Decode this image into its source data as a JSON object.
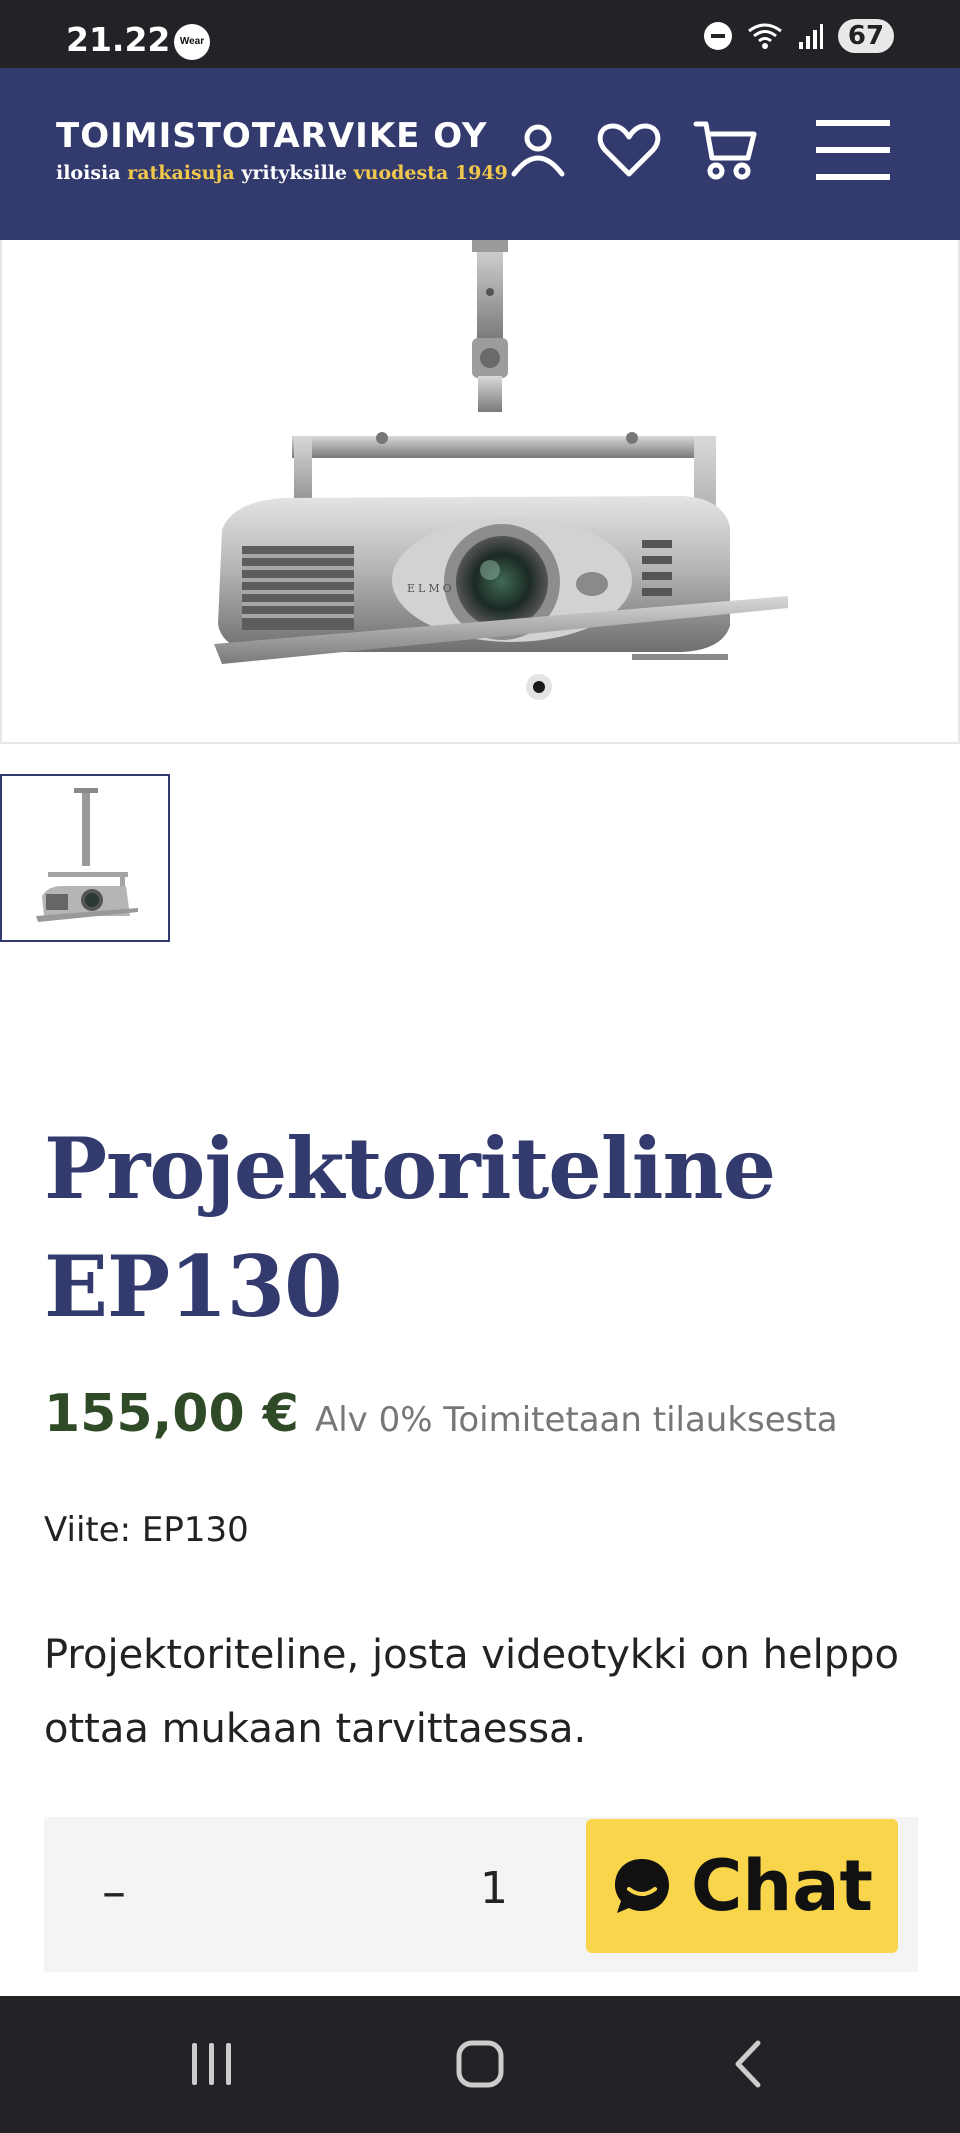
{
  "status_bar": {
    "time": "21.22",
    "wear_label": "Wear",
    "battery": "67"
  },
  "header": {
    "brand": "TOIMISTOTARVIKE OY",
    "tagline": {
      "part1": "iloisia",
      "part2": "ratkaisuja",
      "part3": "yrityksille",
      "part4": "vuodesta 1949"
    },
    "icons": [
      "user-icon",
      "heart-icon",
      "cart-icon",
      "menu-icon"
    ]
  },
  "gallery": {
    "image_brand_mark": "ELMO",
    "slide_count": 1,
    "active_slide": 1
  },
  "product": {
    "title_line1": "Projektoriteline",
    "title_line2": "EP130",
    "price": "155,00 €",
    "price_note": "Alv 0% Toimitetaan tilauksesta",
    "reference": "Viite: EP130",
    "description": "Projektoriteline, josta videotykki on helppo ottaa mukaan tarvittaessa."
  },
  "purchase": {
    "minus_label": "–",
    "quantity": "1",
    "chat_label": "Chat"
  },
  "colors": {
    "header_bg": "#323a6e",
    "title": "#323a6e",
    "price": "#2f4a26",
    "tagline_gold": "#f2c84b",
    "chat_bg": "#f8d54b",
    "system_bars": "#222227"
  }
}
